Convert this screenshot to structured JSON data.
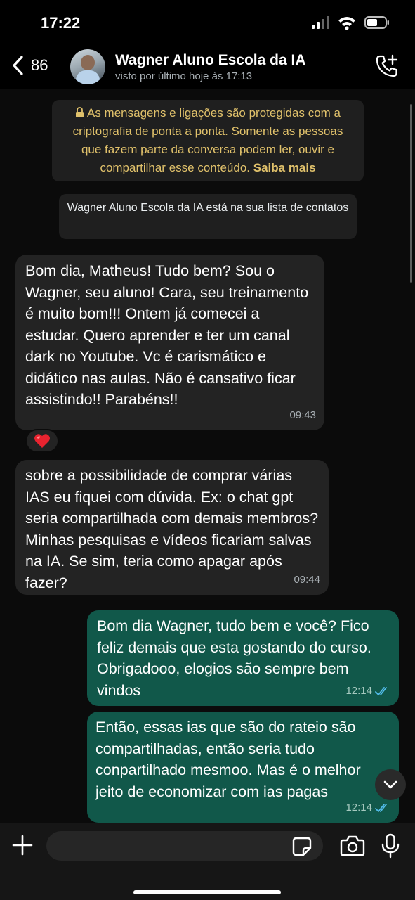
{
  "status_bar": {
    "time": "17:22"
  },
  "header": {
    "back_count": "86",
    "contact_name": "Wagner Aluno Escola da IA",
    "contact_status": "visto por último hoje às 17:13"
  },
  "system_messages": {
    "encryption_text": "As mensagens e ligações são protegidas com a criptografia de ponta a ponta. Somente as pessoas que fazem parte da conversa podem ler, ouvir e compartilhar esse conteúdo.",
    "encryption_link": "Saiba mais",
    "contact_notice": "Wagner Aluno Escola da IA está na sua lista de contatos"
  },
  "messages": [
    {
      "direction": "incoming",
      "text": "Bom dia, Matheus! Tudo bem? Sou o Wagner, seu aluno! Cara, seu treinamento é muito bom!!! Ontem já comecei a estudar. Quero aprender e ter um canal dark no Youtube. Vc é carismático e didático nas aulas. Não é cansativo ficar assistindo!! Parabéns!!",
      "time": "09:43",
      "reaction": "❤️"
    },
    {
      "direction": "incoming",
      "text": "sobre a possibilidade de comprar várias IAS eu fiquei com dúvida. Ex: o chat gpt seria compartilhada com demais membros? Minhas pesquisas e vídeos ficariam salvas na IA. Se sim, teria como apagar após fazer?",
      "time": "09:44"
    },
    {
      "direction": "outgoing",
      "text": "Bom dia Wagner, tudo bem e você? Fico feliz demais que esta gostando do curso. Obrigadooo, elogios são sempre bem vindos",
      "time": "12:14",
      "status": "read"
    },
    {
      "direction": "outgoing",
      "text": "Então, essas ias que são do rateio são compartilhadas, então seria tudo conpartilhado mesmoo. Mas é o melhor jeito de economizar com ias pagas",
      "time": "12:14",
      "status": "read"
    }
  ],
  "input_bar": {
    "placeholder": ""
  },
  "colors": {
    "incoming_bubble": "#232323",
    "outgoing_bubble": "#11584a",
    "read_ticks": "#53bdeb",
    "system_text": "#e0c16b"
  },
  "icons": [
    "back-chevron-icon",
    "add-call-icon",
    "lock-icon",
    "heart-icon",
    "chevron-down-icon",
    "plus-icon",
    "sticker-icon",
    "camera-icon",
    "microphone-icon",
    "signal-icon",
    "wifi-icon",
    "battery-icon"
  ]
}
